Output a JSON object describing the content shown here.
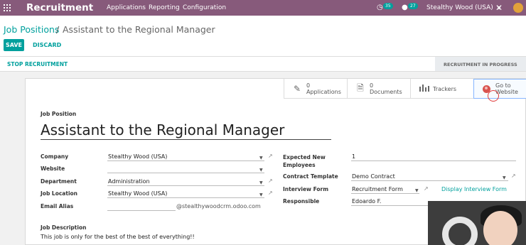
{
  "topbar": {
    "brand": "Recruitment",
    "menu": [
      "Applications",
      "Reporting",
      "Configuration"
    ],
    "activity_count": "35",
    "message_count": "27",
    "company": "Stealthy Wood (USA)",
    "colors": {
      "bar": "#875a7b",
      "accent": "#00a09d"
    }
  },
  "breadcrumb": {
    "parent": "Job Positions",
    "separator": "/",
    "current": "Assistant to the Regional Manager"
  },
  "actions": {
    "save": "SAVE",
    "discard": "DISCARD"
  },
  "status": {
    "stop": "STOP RECRUITMENT",
    "stage": "RECRUITMENT IN PROGRESS"
  },
  "smart_buttons": {
    "applications": {
      "count": "0",
      "label": "Applications",
      "icon": "pencil-icon"
    },
    "documents": {
      "count": "0",
      "label": "Documents",
      "icon": "file-icon"
    },
    "trackers": {
      "label": "Trackers",
      "icon": "bar-chart-icon"
    },
    "website": {
      "label_line1": "Go to",
      "label_line2": "Website",
      "icon": "globe-icon"
    }
  },
  "form": {
    "job_position_label": "Job Position",
    "title": "Assistant to the Regional Manager",
    "left": {
      "company": {
        "label": "Company",
        "value": "Stealthy Wood (USA)"
      },
      "website": {
        "label": "Website",
        "value": ""
      },
      "department": {
        "label": "Department",
        "value": "Administration"
      },
      "job_location": {
        "label": "Job Location",
        "value": "Stealthy Wood (USA)"
      },
      "email_alias": {
        "label": "Email Alias",
        "value": "",
        "domain": "@stealthywoodcrm.odoo.com"
      }
    },
    "right": {
      "expected": {
        "label_line1": "Expected New",
        "label_line2": "Employees",
        "value": "1"
      },
      "contract": {
        "label": "Contract Template",
        "value": "Demo Contract"
      },
      "interview": {
        "label": "Interview Form",
        "value": "Recruitment Form",
        "link": "Display Interview Form"
      },
      "responsible": {
        "label": "Responsible",
        "value": "Edoardo F."
      }
    },
    "description_label": "Job Description",
    "description": "This job is only for the best of the best of everything!!"
  }
}
